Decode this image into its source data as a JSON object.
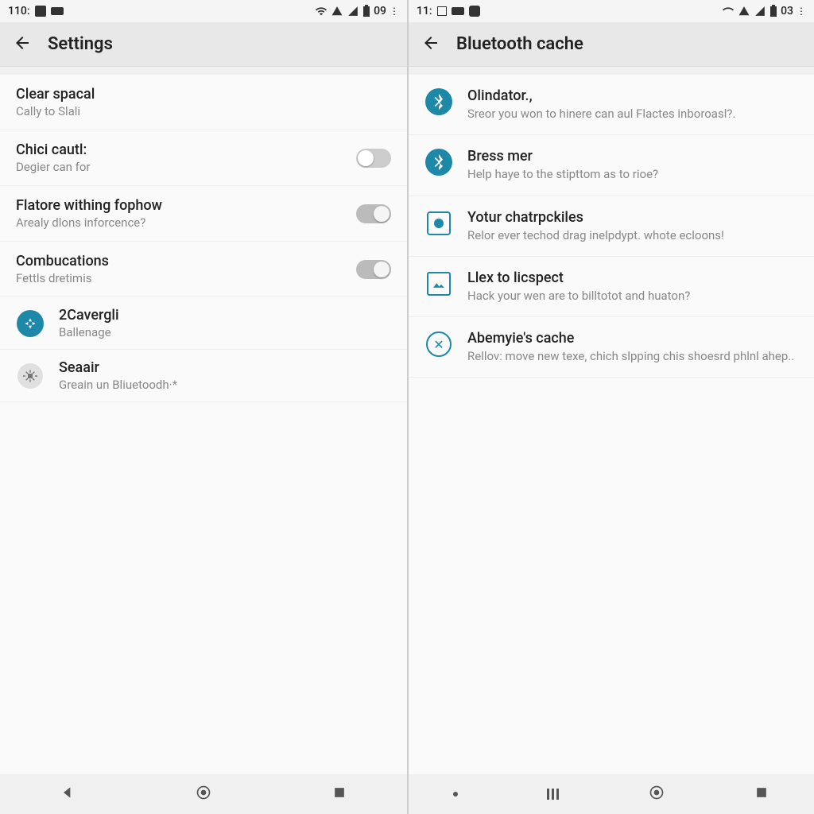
{
  "left": {
    "status": {
      "time": "110:",
      "battery": "09"
    },
    "title": "Settings",
    "items": [
      {
        "title": "Clear spacal",
        "sub": "Cally to Slali"
      },
      {
        "title": "Chici cautl:",
        "sub": "Degier can for"
      },
      {
        "title": "Flatore withing fophow",
        "sub": "Arealy dlons inforcence?"
      },
      {
        "title": "Combucations",
        "sub": "Fettls dretimis"
      },
      {
        "title": "2Cavergli",
        "sub": "Ballenage"
      },
      {
        "title": "Seaair",
        "sub": "Greain un Bliuetoodh·*"
      }
    ]
  },
  "right": {
    "status": {
      "time": "11:",
      "battery": "03"
    },
    "title": "Bluetooth cache",
    "items": [
      {
        "title": "Olindator.,",
        "sub": "Sreor you won to hinere can aul Flactes inboroasl?."
      },
      {
        "title": "Bress mer",
        "sub": "Help haye to the stipttom as to rioe?"
      },
      {
        "title": "Yotur chatrpckiles",
        "sub": "Relor ever techod drag inelpdypt. whote ecloons!"
      },
      {
        "title": "Llex to licspect",
        "sub": "Hack your wen are to billtotot and huaton?"
      },
      {
        "title": "Abemyie's cache",
        "sub": "Rellov: move new texe, chich slpping chis shoesrd phlnl ahep.."
      }
    ]
  }
}
